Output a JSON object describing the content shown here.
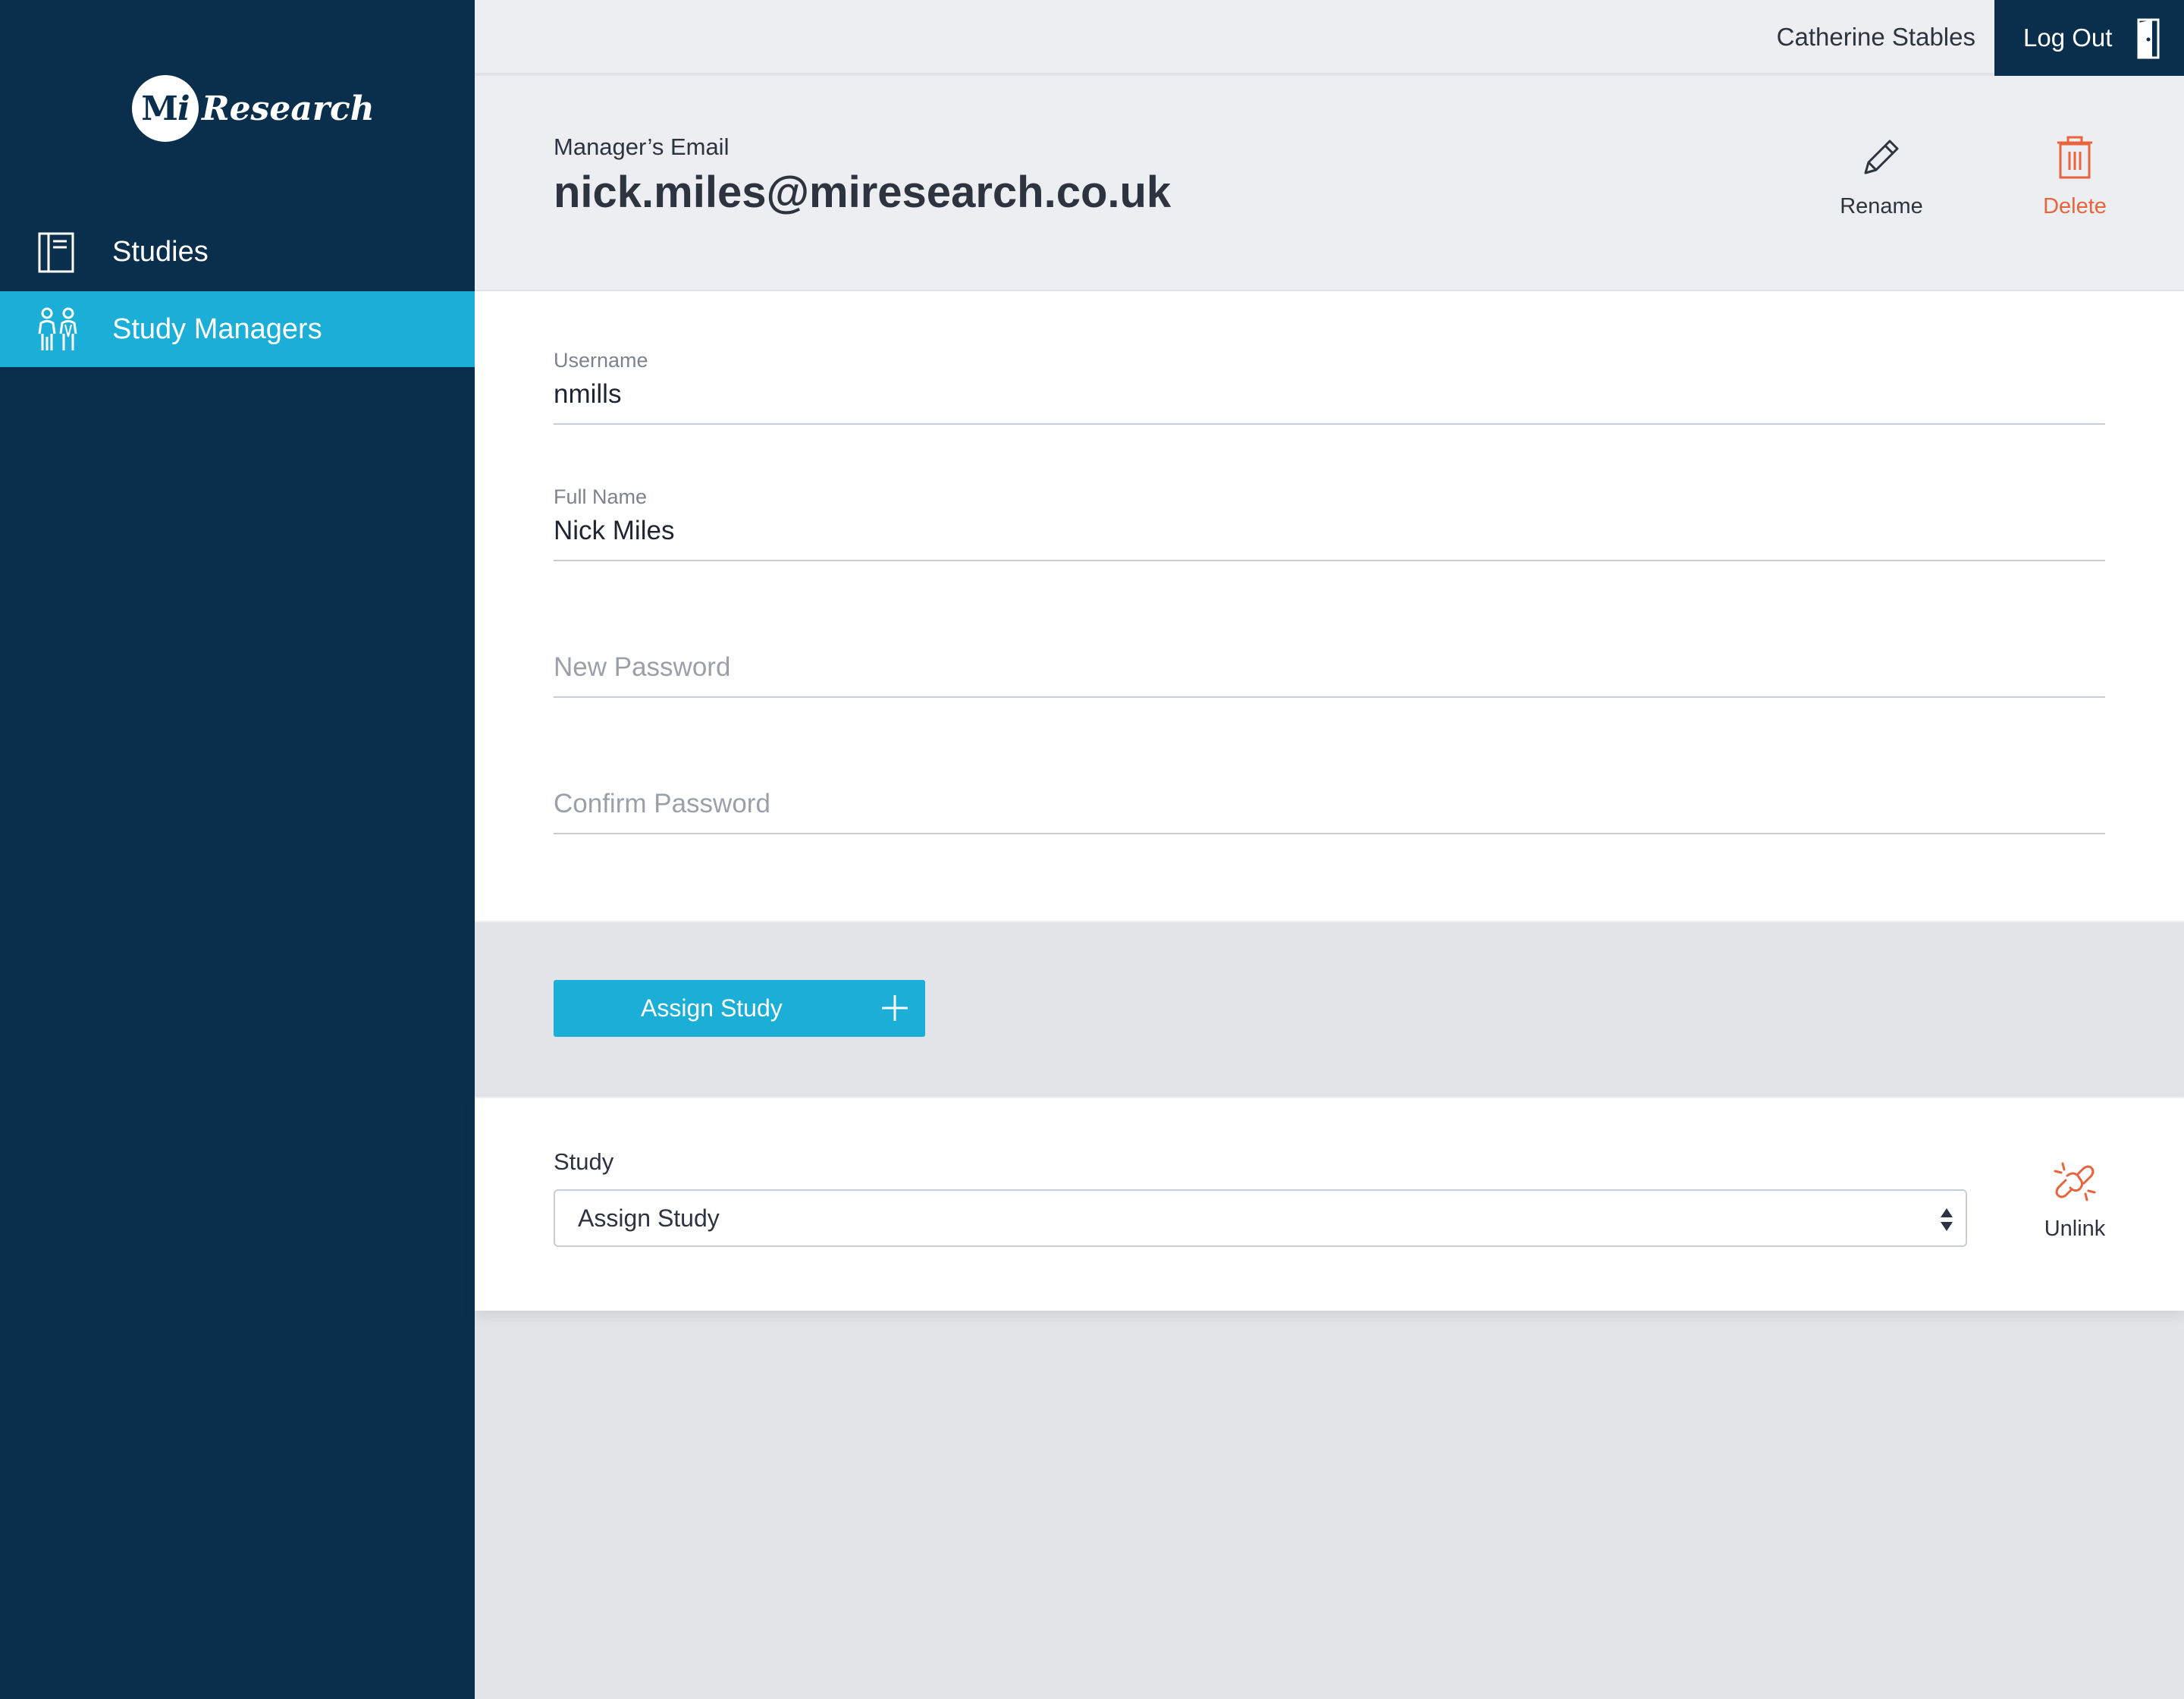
{
  "brand": {
    "logo_mark_m": "M",
    "logo_mark_i": "i",
    "logo_text": "Research"
  },
  "sidebar": {
    "items": [
      {
        "label": "Studies",
        "icon": "document-icon",
        "active": false
      },
      {
        "label": "Study Managers",
        "icon": "people-icon",
        "active": true
      }
    ]
  },
  "topbar": {
    "user_name": "Catherine Stables",
    "logout_label": "Log Out",
    "logout_icon": "door-icon"
  },
  "header": {
    "email_label": "Manager’s Email",
    "email_value": "nick.miles@miresearch.co.uk",
    "rename_label": "Rename",
    "delete_label": "Delete"
  },
  "form": {
    "username": {
      "label": "Username",
      "value": "nmills"
    },
    "full_name": {
      "label": "Full Name",
      "value": "Nick Miles"
    },
    "new_password": {
      "placeholder": "New Password",
      "value": ""
    },
    "confirm_password": {
      "placeholder": "Confirm Password",
      "value": ""
    },
    "assign_button": "Assign Study"
  },
  "study": {
    "label": "Study",
    "selected": "Assign Study",
    "unlink_label": "Unlink"
  },
  "colors": {
    "sidebar_bg": "#0a2f4d",
    "accent": "#1bafd8",
    "danger": "#e8643c",
    "header_bg": "#eceef2"
  }
}
